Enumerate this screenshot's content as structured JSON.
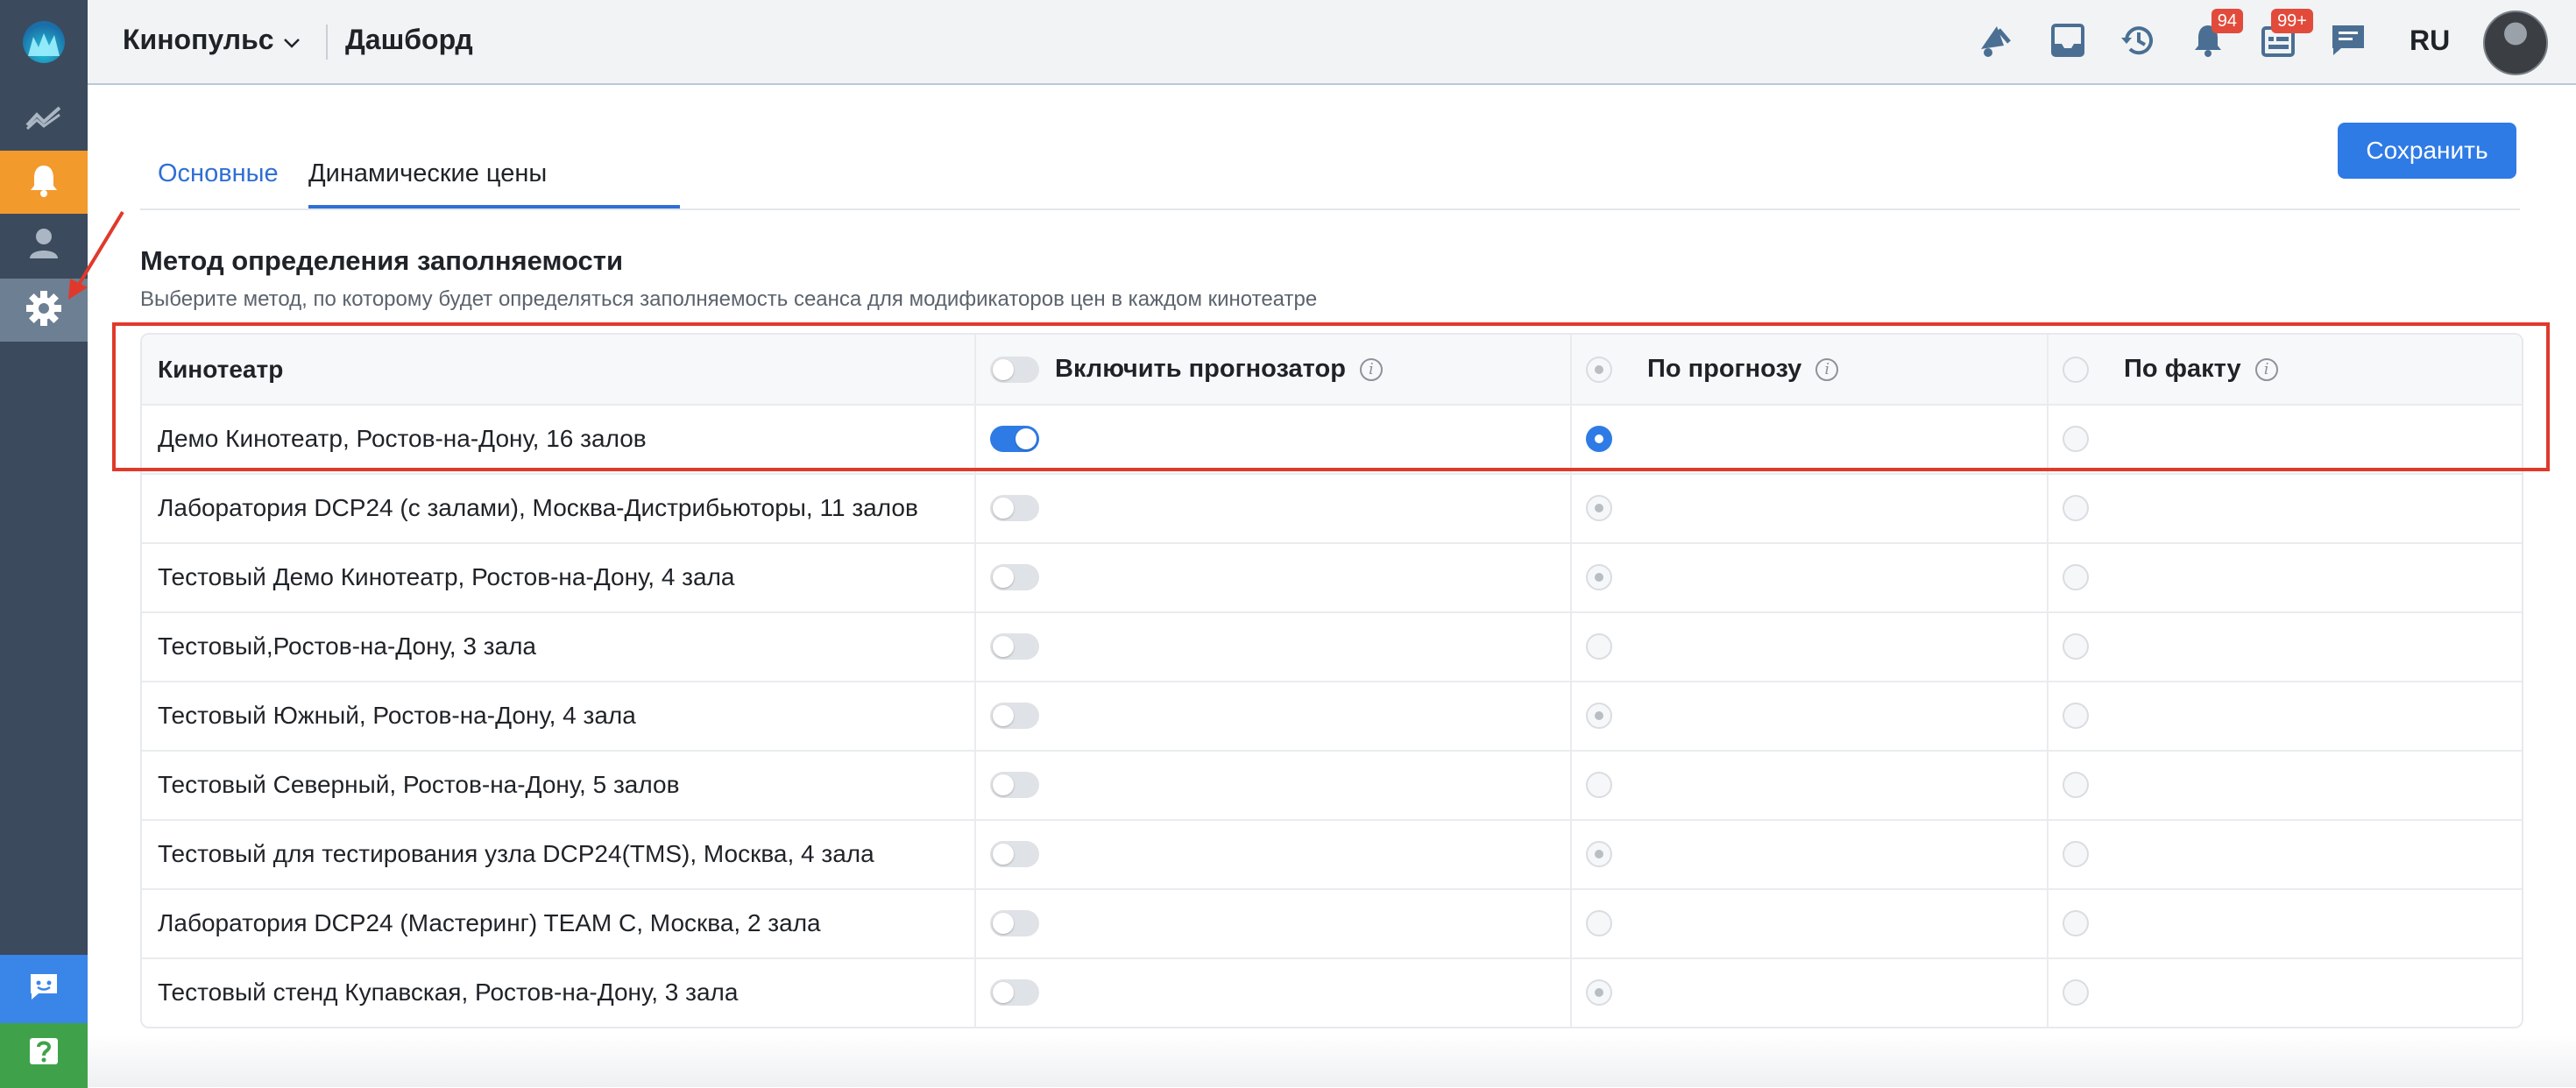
{
  "app": {
    "brand": "Кинопульс",
    "page_title": "Дашборд",
    "language": "RU",
    "badges": {
      "notifications": "94",
      "calendar": "99+"
    }
  },
  "sidebar": {
    "items": [
      {
        "icon": "logo-icon"
      },
      {
        "icon": "analytics-icon"
      },
      {
        "icon": "bell-icon",
        "active_color": "#f39a2d"
      },
      {
        "icon": "user-icon"
      },
      {
        "icon": "gear-icon",
        "active": true
      },
      {
        "icon": "chat-icon",
        "color": "#3a86e8"
      },
      {
        "icon": "help-icon",
        "color": "#3fa24a"
      }
    ]
  },
  "tabs": [
    {
      "label": "Основные",
      "active": false
    },
    {
      "label": "Динамические цены",
      "active": true
    }
  ],
  "actions": {
    "save": "Сохранить"
  },
  "section": {
    "title": "Метод определения заполняемости",
    "subtitle": "Выберите метод, по которому будет определяться заполняемость сеанса для модификаторов цен в каждом кинотеатре"
  },
  "table": {
    "headers": {
      "cinema": "Кинотеатр",
      "forecaster": "Включить прогнозатор",
      "by_forecast": "По прогнозу",
      "by_fact": "По факту"
    },
    "rows": [
      {
        "name": "Демо Кинотеатр, Ростов-на-Дону, 16 залов",
        "forecaster_on": true,
        "method": "forecast"
      },
      {
        "name": "Лаборатория DCP24 (с залами), Москва-Дистрибьюторы, 11 залов",
        "forecaster_on": false,
        "method": "forecast"
      },
      {
        "name": "Тестовый Демо Кинотеатр, Ростов-на-Дону, 4 зала",
        "forecaster_on": false,
        "method": "forecast"
      },
      {
        "name": "Тестовый,Ростов-на-Дону, 3 зала",
        "forecaster_on": false,
        "method": "none"
      },
      {
        "name": "Тестовый Южный, Ростов-на-Дону, 4 зала",
        "forecaster_on": false,
        "method": "forecast"
      },
      {
        "name": "Тестовый Северный, Ростов-на-Дону, 5 залов",
        "forecaster_on": false,
        "method": "none"
      },
      {
        "name": "Тестовый для тестирования узла DCP24(TMS), Москва, 4 зала",
        "forecaster_on": false,
        "method": "forecast"
      },
      {
        "name": "Лаборатория DCP24 (Мастеринг) TEAM C, Москва, 2 зала",
        "forecaster_on": false,
        "method": "none"
      },
      {
        "name": "Тестовый стенд Купавская, Ростов-на-Дону, 3 зала",
        "forecaster_on": false,
        "method": "forecast"
      }
    ]
  },
  "colors": {
    "accent": "#2e7be6",
    "sidebar": "#3b4a5c",
    "highlight": "#e0392b",
    "badge": "#e24b3b"
  }
}
